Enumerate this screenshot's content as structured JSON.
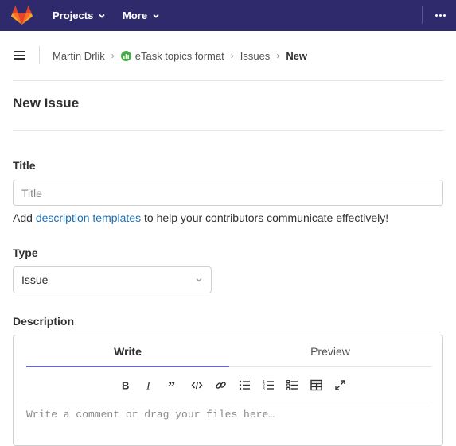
{
  "navbar": {
    "projects_label": "Projects",
    "more_label": "More",
    "background": "#2f2a6b"
  },
  "breadcrumb": {
    "user": "Martin Drlik",
    "project": "eTask topics format",
    "section": "Issues",
    "current": "New"
  },
  "page": {
    "title": "New Issue"
  },
  "form": {
    "title_label": "Title",
    "title_placeholder": "Title",
    "title_value": "",
    "help_prefix": "Add ",
    "help_link": "description templates",
    "help_suffix": " to help your contributors communicate effectively!",
    "type_label": "Type",
    "type_value": "Issue",
    "description_label": "Description",
    "tabs": {
      "write": "Write",
      "preview": "Preview"
    },
    "description_placeholder": "Write a comment or drag your files here…",
    "toolbar_icons": [
      "bold-icon",
      "italic-icon",
      "quote-icon",
      "code-icon",
      "link-icon",
      "bullet-list-icon",
      "numbered-list-icon",
      "task-list-icon",
      "table-icon",
      "fullscreen-icon"
    ]
  },
  "colors": {
    "accent": "#6666c4",
    "link": "#1f6fb2",
    "logo_orange": "#e24329"
  }
}
